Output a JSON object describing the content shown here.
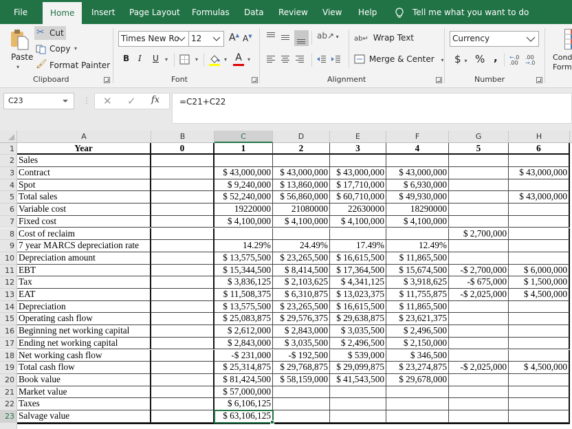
{
  "tabs": [
    {
      "label": "File",
      "active": false
    },
    {
      "label": "Home",
      "active": true
    },
    {
      "label": "Insert",
      "active": false
    },
    {
      "label": "Page Layout",
      "active": false
    },
    {
      "label": "Formulas",
      "active": false
    },
    {
      "label": "Data",
      "active": false
    },
    {
      "label": "Review",
      "active": false
    },
    {
      "label": "View",
      "active": false
    },
    {
      "label": "Help",
      "active": false
    }
  ],
  "tell_me": "Tell me what you want to do",
  "ribbon": {
    "clipboard": {
      "paste": "Paste",
      "cut": "Cut",
      "copy": "Copy",
      "format_painter": "Format Painter",
      "group_label": "Clipboard"
    },
    "font": {
      "font_name": "Times New Ro",
      "font_size": "12",
      "bold": "B",
      "italic": "I",
      "underline": "U",
      "grow": "A",
      "shrink": "A",
      "font_color_letter": "A",
      "highlight_color": "#ffff00",
      "font_color": "#e00000",
      "group_label": "Font"
    },
    "alignment": {
      "wrap_text": "Wrap Text",
      "merge_center": "Merge & Center",
      "group_label": "Alignment"
    },
    "number": {
      "format": "Currency",
      "dollar": "$",
      "percent": "%",
      "comma": ",",
      "group_label": "Number"
    },
    "styles": {
      "conditional_formatting_line1": "Cond",
      "conditional_formatting_line2": "Forma"
    }
  },
  "formula_bar": {
    "name_box": "C23",
    "fx": "fx",
    "formula": "=C21+C22"
  },
  "sheet": {
    "columns": [
      "A",
      "B",
      "C",
      "D",
      "E",
      "F",
      "G",
      "H"
    ],
    "selected_column": "C",
    "selected_row": 23,
    "selected_cell": "C23",
    "rows": [
      {
        "n": "1",
        "cells": [
          "Year",
          "0",
          "1",
          "2",
          "3",
          "4",
          "5",
          "6"
        ]
      },
      {
        "n": "2",
        "cells": [
          "Sales",
          "",
          "",
          "",
          "",
          "",
          "",
          ""
        ]
      },
      {
        "n": "3",
        "cells": [
          "Contract",
          "",
          "$ 43,000,000",
          "$ 43,000,000",
          "$ 43,000,000",
          "$ 43,000,000",
          "",
          "$ 43,000,000"
        ]
      },
      {
        "n": "4",
        "cells": [
          "Spot",
          "",
          "$ 9,240,000",
          "$ 13,860,000",
          "$ 17,710,000",
          "$ 6,930,000",
          "",
          ""
        ]
      },
      {
        "n": "5",
        "cells": [
          "Total sales",
          "",
          "$ 52,240,000",
          "$ 56,860,000",
          "$ 60,710,000",
          "$ 49,930,000",
          "",
          "$ 43,000,000"
        ]
      },
      {
        "n": "6",
        "cells": [
          "Variable cost",
          "",
          "19220000",
          "21080000",
          "22630000",
          "18290000",
          "",
          ""
        ]
      },
      {
        "n": "7",
        "cells": [
          "Fixed cost",
          "",
          "$ 4,100,000",
          "$ 4,100,000",
          "$ 4,100,000",
          "$ 4,100,000",
          "",
          ""
        ]
      },
      {
        "n": "8",
        "cells": [
          "Cost of reclaim",
          "",
          "",
          "",
          "",
          "",
          "$ 2,700,000",
          ""
        ]
      },
      {
        "n": "9",
        "cells": [
          "7 year MARCS depreciation rate",
          "",
          "14.29%",
          "24.49%",
          "17.49%",
          "12.49%",
          "",
          ""
        ]
      },
      {
        "n": "10",
        "cells": [
          "Depreciation amount",
          "",
          "$ 13,575,500",
          "$ 23,265,500",
          "$ 16,615,500",
          "$ 11,865,500",
          "",
          ""
        ]
      },
      {
        "n": "11",
        "cells": [
          "EBT",
          "",
          "$ 15,344,500",
          "$ 8,414,500",
          "$ 17,364,500",
          "$ 15,674,500",
          "-$ 2,700,000",
          "$ 6,000,000"
        ]
      },
      {
        "n": "12",
        "cells": [
          "Tax",
          "",
          "$ 3,836,125",
          "$ 2,103,625",
          "$ 4,341,125",
          "$ 3,918,625",
          "-$ 675,000",
          "$ 1,500,000"
        ]
      },
      {
        "n": "13",
        "cells": [
          "EAT",
          "",
          "$ 11,508,375",
          "$ 6,310,875",
          "$ 13,023,375",
          "$ 11,755,875",
          "-$ 2,025,000",
          "$ 4,500,000"
        ]
      },
      {
        "n": "14",
        "cells": [
          "Depreciation",
          "",
          "$ 13,575,500",
          "$ 23,265,500",
          "$ 16,615,500",
          "$ 11,865,500",
          "",
          ""
        ]
      },
      {
        "n": "15",
        "cells": [
          "Operating cash flow",
          "",
          "$ 25,083,875",
          "$ 29,576,375",
          "$ 29,638,875",
          "$ 23,621,375",
          "",
          ""
        ]
      },
      {
        "n": "16",
        "cells": [
          "Beginning net working capital",
          "",
          "$ 2,612,000",
          "$ 2,843,000",
          "$ 3,035,500",
          "$ 2,496,500",
          "",
          ""
        ]
      },
      {
        "n": "17",
        "cells": [
          "Ending net working capital",
          "",
          "$ 2,843,000",
          "$ 3,035,500",
          "$ 2,496,500",
          "$ 2,150,000",
          "",
          ""
        ]
      },
      {
        "n": "18",
        "cells": [
          "Net working cash flow",
          "",
          "-$ 231,000",
          "-$ 192,500",
          "$ 539,000",
          "$ 346,500",
          "",
          ""
        ]
      },
      {
        "n": "19",
        "cells": [
          "Total cash flow",
          "",
          "$ 25,314,875",
          "$ 29,768,875",
          "$ 29,099,875",
          "$ 23,274,875",
          "-$ 2,025,000",
          "$ 4,500,000"
        ]
      },
      {
        "n": "20",
        "cells": [
          "Book value",
          "",
          "$ 81,424,500",
          "$ 58,159,000",
          "$ 41,543,500",
          "$ 29,678,000",
          "",
          ""
        ]
      },
      {
        "n": "21",
        "cells": [
          "Market value",
          "",
          "$ 57,000,000",
          "",
          "",
          "",
          "",
          ""
        ]
      },
      {
        "n": "22",
        "cells": [
          "Taxes",
          "",
          "$ 6,106,125",
          "",
          "",
          "",
          "",
          ""
        ]
      },
      {
        "n": "23",
        "cells": [
          "Salvage value",
          "",
          "$ 63,106,125",
          "",
          "",
          "",
          "",
          ""
        ]
      }
    ]
  },
  "colors": {
    "accent": "#217346",
    "ribbon_bg": "#f3f3f3",
    "header_bg": "#e6e6e6"
  }
}
